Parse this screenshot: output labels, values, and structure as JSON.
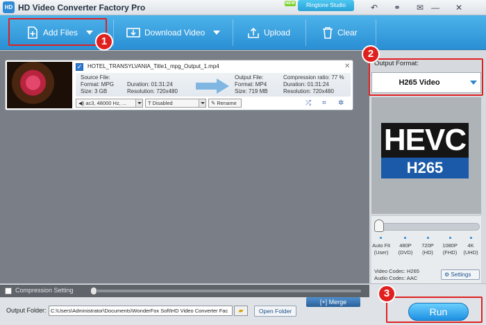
{
  "app": {
    "title": "HD Video Converter Factory Pro",
    "logo_text": "HD",
    "new_badge": "NEW",
    "ringtone_label": "Ringtone Studio"
  },
  "window_controls": {
    "undo": "↶",
    "connect": "⚭",
    "feedback": "✉",
    "minimize": "—",
    "close": "✕"
  },
  "toolbar": {
    "add_files": "Add Files",
    "download_video": "Download Video",
    "upload": "Upload",
    "clear": "Clear"
  },
  "steps": {
    "one": "1",
    "two": "2",
    "three": "3"
  },
  "file_item": {
    "name": "HOTEL_TRANSYLVANIA_Title1_mpg_Output_1.mp4",
    "source": {
      "label": "Source File:",
      "format": "Format: MPG",
      "size": "Size: 3 GB",
      "duration": "Duration: 01:31:24",
      "resolution": "Resolution: 720x480"
    },
    "output": {
      "label": "Output File:",
      "format": "Format: MP4",
      "size": "Size: 719 MB",
      "duration": "Duration: 01:31:24",
      "resolution": "Resolution: 720x480",
      "compression": "Compression ratio: 77 %"
    },
    "audio_track": "ac3, 48000 Hz, ...",
    "subtitle": "Disabled",
    "rename": "Rename"
  },
  "output_format": {
    "label": "Output Format:",
    "value": "H265 Video",
    "logo_top": "HEVC",
    "logo_bottom": "H265"
  },
  "quality": {
    "options": [
      {
        "top": "Auto Fit",
        "bottom": "(User)"
      },
      {
        "top": "480P",
        "bottom": "(DVD)"
      },
      {
        "top": "720P",
        "bottom": "(HD)"
      },
      {
        "top": "1080P",
        "bottom": "(FHD)"
      },
      {
        "top": "4K",
        "bottom": "(UHD)"
      }
    ],
    "selected": "Auto Fit"
  },
  "codec": {
    "video": "Video Codec: H265",
    "audio": "Audio Codec: AAC",
    "settings": "Settings"
  },
  "bottom": {
    "compression_label": "Compression Setting",
    "folder_label": "Output Folder:",
    "folder_path": "C:\\Users\\Administrator\\Documents\\WonderFox Soft\\HD Video Converter Fac",
    "open_folder": "Open Folder",
    "merge": "Merge",
    "run": "Run"
  },
  "colors": {
    "accent": "#2a8fd4",
    "highlight": "#e0201e"
  }
}
